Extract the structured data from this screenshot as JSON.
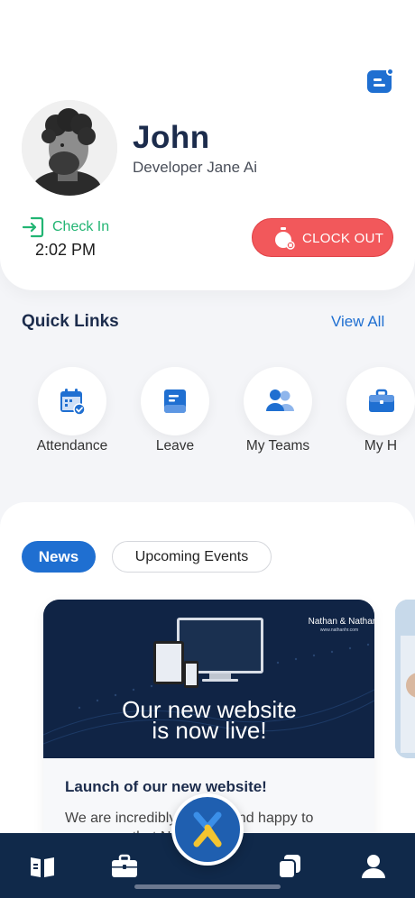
{
  "profile": {
    "name": "John",
    "role": "Developer Jane Ai",
    "checkin_label": "Check In",
    "checkin_time": "2:02 PM",
    "clockout_label": "CLOCK OUT"
  },
  "quick_links": {
    "title": "Quick Links",
    "view_all": "View All",
    "items": [
      {
        "label": "Attendance",
        "icon": "calendar-check-icon"
      },
      {
        "label": "Leave",
        "icon": "document-icon"
      },
      {
        "label": "My Teams",
        "icon": "users-icon"
      },
      {
        "label": "My H",
        "icon": "briefcase-icon"
      }
    ]
  },
  "news": {
    "tabs": [
      {
        "label": "News",
        "active": true
      },
      {
        "label": "Upcoming Events",
        "active": false
      }
    ],
    "card": {
      "image_brand": "Nathan & Nathan",
      "image_url_text": "www.nathanhr.com",
      "image_headline_1": "Our new website",
      "image_headline_2": "is now live!",
      "title": "Launch of our new website!",
      "description": "We are incredibly excited and happy to announce that Nathan & ..."
    }
  },
  "bottom_nav": {
    "items": [
      "book-icon",
      "briefcase-icon",
      "home-fab-icon",
      "copy-icon",
      "user-icon"
    ]
  },
  "colors": {
    "primary": "#1f6fd1",
    "navy": "#10294a",
    "checkin_green": "#22b573",
    "clockout_red": "#f2585b"
  }
}
